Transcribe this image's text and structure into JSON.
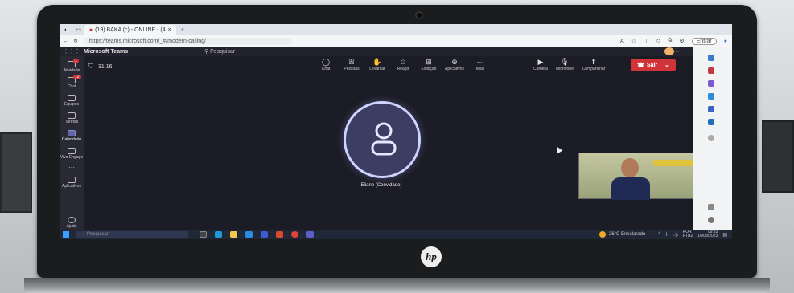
{
  "browser": {
    "tab_active_label": "(19) BAKA (c) - ONLINE - (4",
    "tab_close": "×",
    "new_tab": "+",
    "url": "https://teams.microsoft.com/_#/modern-calling/",
    "signin_label": "Entrar"
  },
  "teams": {
    "app_title": "Microsoft Teams",
    "search_placeholder": "Pesquisar",
    "more": "···"
  },
  "rail": {
    "items": [
      {
        "label": "Atividade",
        "badge": "1"
      },
      {
        "label": "Chat",
        "badge": "12"
      },
      {
        "label": "Equipes",
        "badge": ""
      },
      {
        "label": "Tarefas",
        "badge": ""
      },
      {
        "label": "Calendário",
        "badge": ""
      },
      {
        "label": "Viva Engage",
        "badge": ""
      },
      {
        "label": "···",
        "badge": ""
      },
      {
        "label": "Aplicativos",
        "badge": ""
      },
      {
        "label": "Ajuda",
        "badge": ""
      }
    ]
  },
  "meeting": {
    "timer": "31:16",
    "tools": [
      {
        "label": "Chat",
        "icon": "chat-icon",
        "glyph": "◯"
      },
      {
        "label": "Pessoas",
        "icon": "people-icon",
        "glyph": "ꕤ"
      },
      {
        "label": "Levantar",
        "icon": "raise-hand-icon",
        "glyph": "✋"
      },
      {
        "label": "Reagir",
        "icon": "react-icon",
        "glyph": "☺"
      },
      {
        "label": "Exibição",
        "icon": "view-icon",
        "glyph": "⊞"
      },
      {
        "label": "Aplicativos",
        "icon": "apps-icon",
        "glyph": "⊕"
      },
      {
        "label": "Mais",
        "icon": "more-icon",
        "glyph": "···"
      }
    ],
    "av": [
      {
        "label": "Câmera",
        "icon": "camera-icon",
        "glyph": "▶"
      },
      {
        "label": "Microfone",
        "icon": "mic-icon",
        "glyph": "🎙"
      },
      {
        "label": "Compartilhar",
        "icon": "share-icon",
        "glyph": "⬆"
      }
    ],
    "leave_label": "Sair",
    "participant_name": "Eliane (Convidado)"
  },
  "taskbar": {
    "search_placeholder": "Pesquisar",
    "weather": "26°C  Ensolarado",
    "lang_top": "POR",
    "lang_bottom": "PTB2",
    "time": "09:33",
    "date": "16/08/2023"
  },
  "colors": {
    "leave": "#d13438",
    "accent": "#6264a7"
  }
}
